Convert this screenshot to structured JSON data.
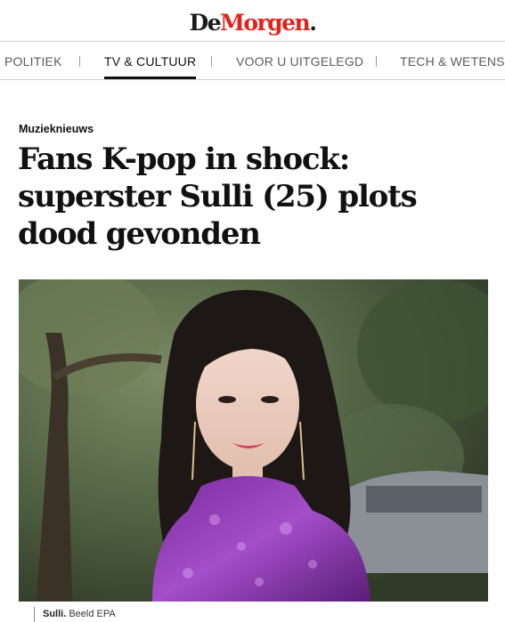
{
  "brand": {
    "logo_de": "De",
    "logo_morgen": "Morgen",
    "logo_dot": ".",
    "colors": {
      "logo_red": "#e1241b",
      "text": "#111111",
      "nav_grey": "#5b5b5b"
    }
  },
  "nav": {
    "items": [
      {
        "label": "POLITIEK",
        "active": false
      },
      {
        "label": "TV & CULTUUR",
        "active": true
      },
      {
        "label": "VOOR U UITGELEGD",
        "active": false
      },
      {
        "label": "TECH & WETENSCH",
        "active": false
      }
    ]
  },
  "article": {
    "kicker": "Muzieknieuws",
    "headline_line1": "Fans K-pop in shock:",
    "headline_line2": "superster Sulli (25) plots",
    "headline_line3": "dood gevonden",
    "caption_name": "Sulli.",
    "caption_credit": "Beeld EPA"
  }
}
